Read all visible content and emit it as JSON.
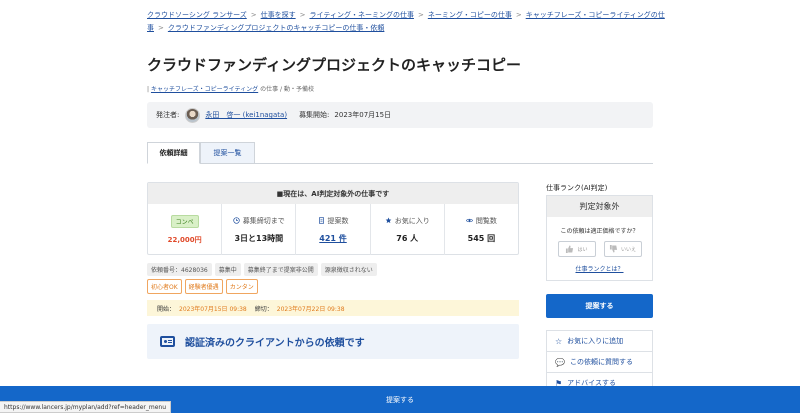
{
  "breadcrumb": {
    "items": [
      "クラウドソーシング ランサーズ",
      "仕事を探す",
      "ライティング・ネーミングの仕事",
      "ネーミング・コピーの仕事",
      "キャッチフレーズ・コピーライティングの仕事",
      "クラウドファンディングプロジェクトのキャッチコピーの仕事・依頼"
    ],
    "separator": ">"
  },
  "page_title": "クラウドファンディングプロジェクトのキャッチコピー",
  "category": {
    "prefix": "|",
    "link": "キャッチフレーズ・コピーライティング",
    "suffix": "の仕事 / 動・予備校"
  },
  "client": {
    "label": "発注者:",
    "name": "永田　啓一 (kei1nagata)",
    "start_label": "募集開始:",
    "start_date": "2023年07月15日"
  },
  "tabs": [
    {
      "label": "依頼詳細",
      "active": true
    },
    {
      "label": "提案一覧",
      "active": false
    }
  ],
  "stats": {
    "header": "■現在は、AI判定対象外の仕事です",
    "compe_badge": "コンペ",
    "price": "22,000円",
    "deadline_label": "募集締切まで",
    "deadline_value": "3日と13時間",
    "proposals_label": "提案数",
    "proposals_value": "421 件",
    "favorites_label": "お気に入り",
    "favorites_value": "76 人",
    "views_label": "閲覧数",
    "views_value": "545 回"
  },
  "tags_gray": [
    "依頼番号：4628036",
    "募集中",
    "募集終了まで提案非公開",
    "源泉徴収されない"
  ],
  "tags_orange": [
    "初心者OK",
    "経験者優遇",
    "カンタン"
  ],
  "period": {
    "start_label": "開始：",
    "start_value": "2023年07月15日 09:38",
    "end_label": "締切：",
    "end_value": "2023年07月22日 09:38"
  },
  "verified_text": "認証済みのクライアントからの依頼です",
  "rank": {
    "title": "仕事ランク(AI判定)",
    "header": "判定対象外",
    "question": "この依頼は適正価格ですか？",
    "yes": "はい",
    "no": "いいえ",
    "link": "仕事ランクとは？"
  },
  "propose_button": "提案する",
  "side_actions": [
    "お気に入りに追加",
    "この依頼に質問する",
    "アドバイスする"
  ],
  "bottom_bar_label": "提案する",
  "status_url": "https://www.lancers.jp/myplan/add?ref=header_menu",
  "colors": {
    "accent": "#1467c9",
    "link": "#1f4f9e",
    "price": "#e04a2a",
    "tag_orange": "#e07a1b"
  }
}
